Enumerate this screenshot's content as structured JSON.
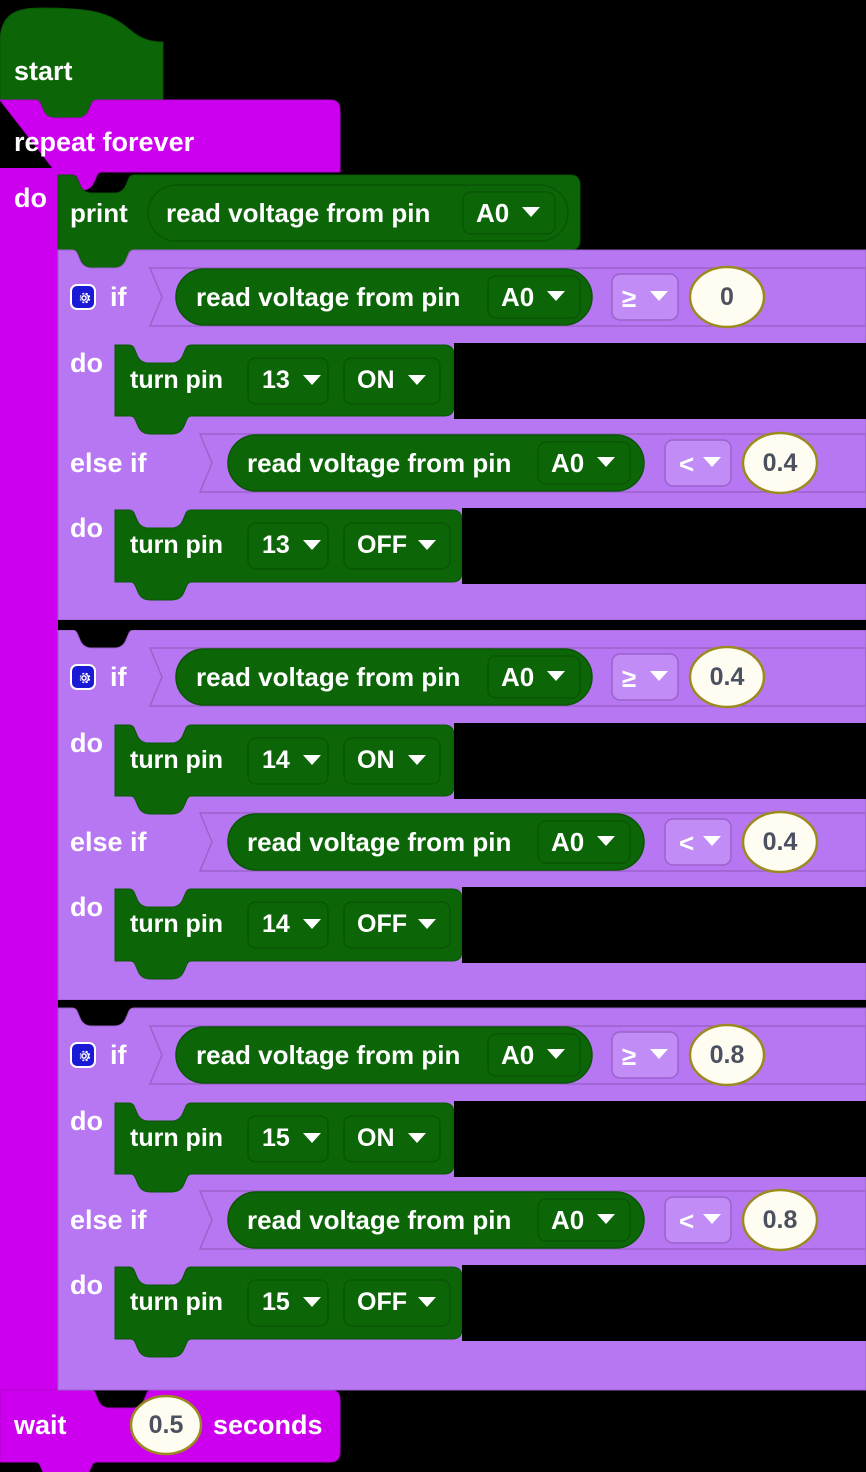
{
  "program": {
    "start_block": {
      "label": "start"
    },
    "loop_block": {
      "label": "repeat forever",
      "do_label": "do"
    },
    "print_statement": {
      "label": "print",
      "value_block": {
        "label": "read voltage from pin",
        "pin": "A0",
        "caret": "chevron-down-icon"
      }
    },
    "wait_block": {
      "label": "wait",
      "seconds": "0.5",
      "unit_label": "seconds"
    },
    "if_blocks": [
      {
        "mutator_icon": "gear-icon",
        "if_label": "if",
        "do_label": "do",
        "else_if_label": "else if",
        "else_do_label": "do",
        "condition": {
          "sensor_label": "read voltage from pin",
          "pin": "A0",
          "operator": "≥",
          "value": "0"
        },
        "action": {
          "label": "turn pin",
          "pin": "13",
          "state": "ON"
        },
        "else_condition": {
          "sensor_label": "read voltage from pin",
          "pin": "A0",
          "operator": "<",
          "value": "0.4"
        },
        "else_action": {
          "label": "turn pin",
          "pin": "13",
          "state": "OFF"
        }
      },
      {
        "mutator_icon": "gear-icon",
        "if_label": "if",
        "do_label": "do",
        "else_if_label": "else if",
        "else_do_label": "do",
        "condition": {
          "sensor_label": "read voltage from pin",
          "pin": "A0",
          "operator": "≥",
          "value": "0.4"
        },
        "action": {
          "label": "turn pin",
          "pin": "14",
          "state": "ON"
        },
        "else_condition": {
          "sensor_label": "read voltage from pin",
          "pin": "A0",
          "operator": "<",
          "value": "0.4"
        },
        "else_action": {
          "label": "turn pin",
          "pin": "14",
          "state": "OFF"
        }
      },
      {
        "mutator_icon": "gear-icon",
        "if_label": "if",
        "do_label": "do",
        "else_if_label": "else if",
        "else_do_label": "do",
        "condition": {
          "sensor_label": "read voltage from pin",
          "pin": "A0",
          "operator": "≥",
          "value": "0.8"
        },
        "action": {
          "label": "turn pin",
          "pin": "15",
          "state": "ON"
        },
        "else_condition": {
          "sensor_label": "read voltage from pin",
          "pin": "A0",
          "operator": "<",
          "value": "0.8"
        },
        "else_action": {
          "label": "turn pin",
          "pin": "15",
          "state": "OFF"
        }
      }
    ]
  },
  "colors": {
    "background": "#000000",
    "green_block": "#0c6608",
    "green_block_stroke": "#0a5506",
    "magenta_block": "#cc00ee",
    "magenta_stroke": "#b000cc",
    "purple_block": "#b877f2",
    "purple_stroke": "#9a62ca",
    "field_border": "#9a8b1f",
    "field_fill": "#fffdf2",
    "number_text": "#4c5161",
    "gear_icon_bg": "#1a1ad6",
    "text_white": "#ffffff"
  }
}
